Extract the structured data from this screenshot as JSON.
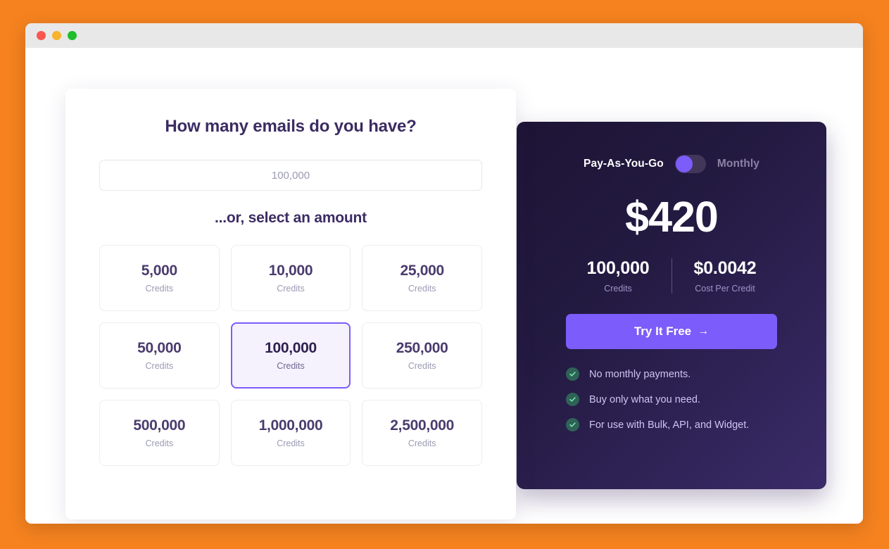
{
  "window": {
    "traffic_lights": [
      "close",
      "minimize",
      "maximize"
    ]
  },
  "selector": {
    "question_title": "How many emails do you have?",
    "input_placeholder": "100,000",
    "input_value": "",
    "or_title": "...or, select an amount",
    "credit_label": "Credits",
    "options": [
      {
        "amount": "5,000",
        "label": "Credits",
        "selected": false
      },
      {
        "amount": "10,000",
        "label": "Credits",
        "selected": false
      },
      {
        "amount": "25,000",
        "label": "Credits",
        "selected": false
      },
      {
        "amount": "50,000",
        "label": "Credits",
        "selected": false
      },
      {
        "amount": "100,000",
        "label": "Credits",
        "selected": true
      },
      {
        "amount": "250,000",
        "label": "Credits",
        "selected": false
      },
      {
        "amount": "500,000",
        "label": "Credits",
        "selected": false
      },
      {
        "amount": "1,000,000",
        "label": "Credits",
        "selected": false
      },
      {
        "amount": "2,500,000",
        "label": "Credits",
        "selected": false
      }
    ]
  },
  "pricing": {
    "plan_toggle": {
      "left_label": "Pay-As-You-Go",
      "right_label": "Monthly",
      "active_side": "left"
    },
    "price": "$420",
    "stats": [
      {
        "value": "100,000",
        "label": "Credits"
      },
      {
        "value": "$0.0042",
        "label": "Cost Per Credit"
      }
    ],
    "cta_label": "Try It Free",
    "cta_arrow": "→",
    "features": [
      "No monthly payments.",
      "Buy only what you need.",
      "For use with Bulk, API, and Widget."
    ]
  },
  "colors": {
    "page_background": "#F5821F",
    "accent_purple": "#7C5CFA",
    "panel_dark": "#1D1435",
    "panel_light": "#3B2B69",
    "heading_text": "#3B2C63",
    "check_badge": "#2F6357"
  }
}
